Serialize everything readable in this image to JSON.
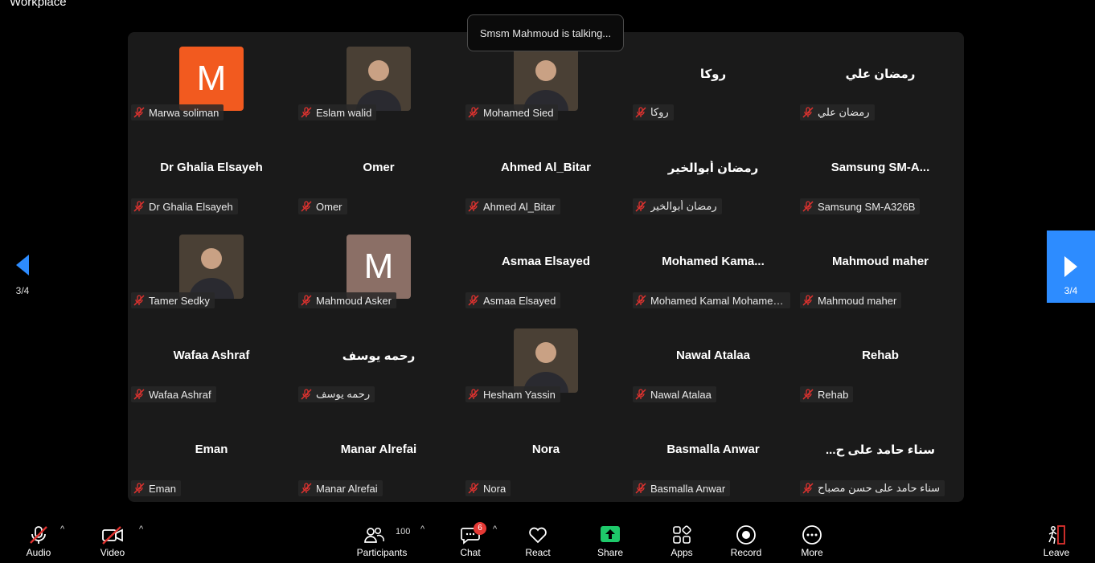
{
  "app": {
    "title": "Workplace"
  },
  "toast": {
    "text": "Smsm Mahmoud is talking..."
  },
  "pagination": {
    "indicator": "3/4"
  },
  "tiles": [
    {
      "center": "",
      "tag": "Marwa soliman",
      "avatar": "letter",
      "letter": "M",
      "bg": "#f25a1f"
    },
    {
      "center": "",
      "tag": "Eslam walid",
      "avatar": "photo"
    },
    {
      "center": "",
      "tag": "Mohamed Sied",
      "avatar": "photo"
    },
    {
      "center": "روكا",
      "tag": "روكا"
    },
    {
      "center": "رمضان علي",
      "tag": "رمضان علي"
    },
    {
      "center": "Dr Ghalia Elsayeh",
      "tag": "Dr Ghalia Elsayeh"
    },
    {
      "center": "Omer",
      "tag": "Omer"
    },
    {
      "center": "Ahmed Al_Bitar",
      "tag": "Ahmed Al_Bitar"
    },
    {
      "center": "رمضان أبوالخير",
      "tag": "رمضان أبوالخير"
    },
    {
      "center": "Samsung  SM-A...",
      "tag": "Samsung SM-A326B"
    },
    {
      "center": "",
      "tag": "Tamer Sedky",
      "avatar": "photo"
    },
    {
      "center": "",
      "tag": "Mahmoud Asker",
      "avatar": "letter",
      "letter": "M",
      "bg": "#8b6f66"
    },
    {
      "center": "Asmaa Elsayed",
      "tag": "Asmaa Elsayed"
    },
    {
      "center": "Mohamed  Kama...",
      "tag": "Mohamed Kamal Mohamed ..."
    },
    {
      "center": "Mahmoud maher",
      "tag": "Mahmoud maher"
    },
    {
      "center": "Wafaa Ashraf",
      "tag": "Wafaa Ashraf"
    },
    {
      "center": "رحمه يوسف",
      "tag": "رحمه يوسف"
    },
    {
      "center": "",
      "tag": "Hesham Yassin",
      "avatar": "photo"
    },
    {
      "center": "Nawal Atalaa",
      "tag": "Nawal Atalaa"
    },
    {
      "center": "Rehab",
      "tag": "Rehab"
    },
    {
      "center": "Eman",
      "tag": "Eman"
    },
    {
      "center": "Manar Alrefai",
      "tag": "Manar Alrefai"
    },
    {
      "center": "Nora",
      "tag": "Nora"
    },
    {
      "center": "Basmalla Anwar",
      "tag": "Basmalla Anwar"
    },
    {
      "center": "...سناء حامد على ح",
      "tag": "سناء حامد على حسن مصباح"
    }
  ],
  "toolbar": {
    "audio": "Audio",
    "video": "Video",
    "participants": "Participants",
    "participants_count": "100",
    "chat": "Chat",
    "chat_badge": "6",
    "react": "React",
    "share": "Share",
    "apps": "Apps",
    "record": "Record",
    "more": "More",
    "leave": "Leave"
  },
  "colors": {
    "accent": "#2d8cff",
    "share": "#1ec96a",
    "badge": "#e53935",
    "muted_mic": "#e0322f"
  }
}
